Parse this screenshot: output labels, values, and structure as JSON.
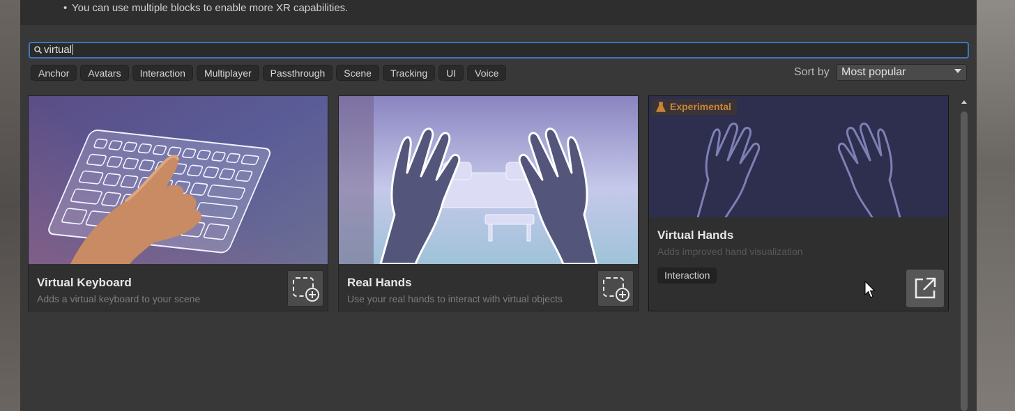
{
  "info": {
    "bullet": "•",
    "line": "You can use multiple blocks to enable more XR capabilities."
  },
  "search": {
    "value": "virtual"
  },
  "filters": [
    "Anchor",
    "Avatars",
    "Interaction",
    "Multiplayer",
    "Passthrough",
    "Scene",
    "Tracking",
    "UI",
    "Voice"
  ],
  "sort": {
    "label": "Sort by",
    "selected": "Most popular"
  },
  "cards": [
    {
      "title": "Virtual Keyboard",
      "description": "Adds a virtual keyboard to your scene"
    },
    {
      "title": "Real Hands",
      "description": "Use your real hands to interact with virtual objects"
    },
    {
      "badge": "Experimental",
      "title": "Virtual Hands",
      "description": "Adds improved hand visualization",
      "tag": "Interaction"
    }
  ],
  "colors": {
    "accent_blue": "#3a79bb",
    "experimental_orange": "#c9843a",
    "panel": "#383838"
  },
  "icons": {
    "search": "search-icon",
    "sort": "chevron-down-icon",
    "add": "add-block-icon",
    "open": "external-link-icon",
    "experimental": "flask-icon"
  }
}
